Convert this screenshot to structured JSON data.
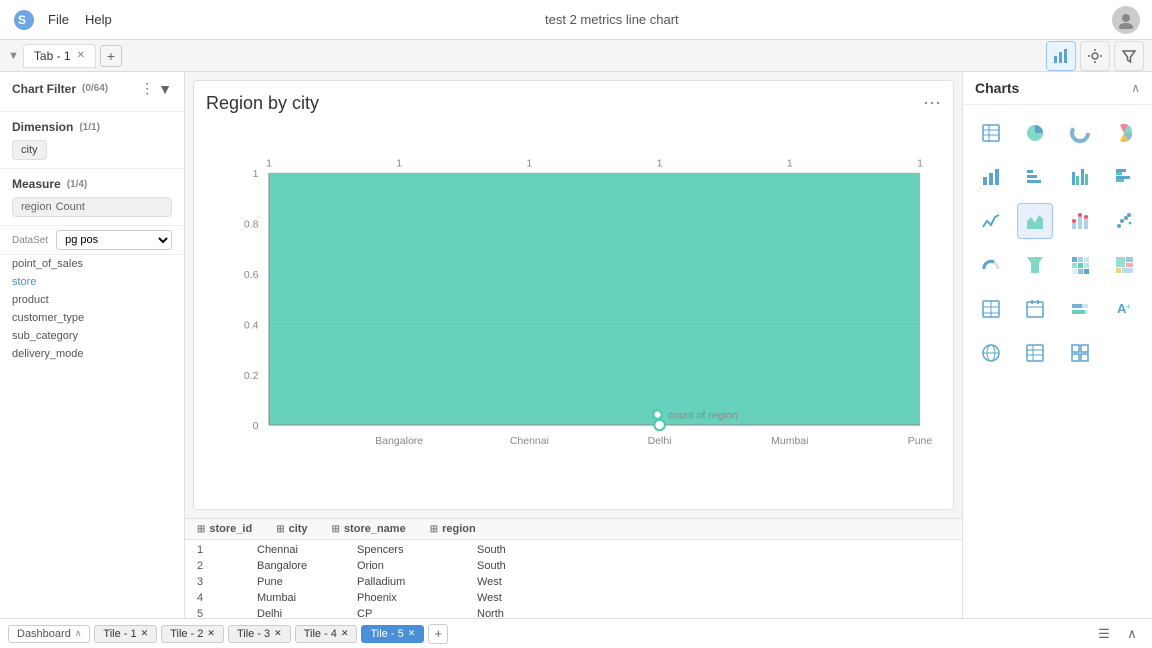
{
  "app": {
    "title": "test 2 metrics line chart",
    "menu": [
      "File",
      "Help"
    ]
  },
  "tabs": [
    {
      "label": "Tab - 1",
      "closable": true
    }
  ],
  "toolbar": {
    "chart_icon": "▦",
    "filter_icon": "⚙",
    "funnel_icon": "⊘"
  },
  "chart_filter": {
    "label": "Chart Filter",
    "badge": "(0/64)"
  },
  "dimension": {
    "label": "Dimension",
    "badge": "(1/1)",
    "value": "city"
  },
  "measure": {
    "label": "Measure",
    "badge": "(1/4)",
    "field": "region",
    "agg": "Count"
  },
  "chart_title": "Region by city",
  "chart": {
    "y_labels": [
      "1",
      "0.8",
      "0.6",
      "0.4",
      "0.2",
      "0"
    ],
    "x_labels": [
      "Bangalore",
      "Chennai",
      "Delhi",
      "Mumbai",
      "Pune"
    ],
    "x_top_labels": [
      "1",
      "1",
      "1",
      "1",
      "1"
    ],
    "series_label": "count of region"
  },
  "charts_panel": {
    "title": "Charts",
    "icons": [
      {
        "name": "table",
        "symbol": "⊞",
        "selected": false
      },
      {
        "name": "pie",
        "symbol": "◕",
        "selected": false
      },
      {
        "name": "donut",
        "symbol": "◎",
        "selected": false
      },
      {
        "name": "rose",
        "symbol": "✿",
        "selected": false
      },
      {
        "name": "bar",
        "symbol": "▮▮▮",
        "selected": false
      },
      {
        "name": "hbar",
        "symbol": "≡",
        "selected": false
      },
      {
        "name": "grouped-bar",
        "symbol": "▐▌",
        "selected": false
      },
      {
        "name": "grouped-hbar",
        "symbol": "≣",
        "selected": false
      },
      {
        "name": "line",
        "symbol": "📈",
        "selected": false
      },
      {
        "name": "area",
        "symbol": "◣",
        "selected": true
      },
      {
        "name": "scatter-bar",
        "symbol": "▬▬",
        "selected": false
      },
      {
        "name": "scatter",
        "symbol": "⠿",
        "selected": false
      },
      {
        "name": "gauge",
        "symbol": "◑",
        "selected": false
      },
      {
        "name": "funnel",
        "symbol": "▽",
        "selected": false
      },
      {
        "name": "heatmap",
        "symbol": "⊟",
        "selected": false
      },
      {
        "name": "treemap",
        "symbol": "▦",
        "selected": false
      },
      {
        "name": "table2",
        "symbol": "⊡",
        "selected": false
      },
      {
        "name": "calendar",
        "symbol": "▤",
        "selected": false
      },
      {
        "name": "bar2",
        "symbol": "▪▪▪",
        "selected": false
      },
      {
        "name": "text",
        "symbol": "A⁺",
        "selected": false
      },
      {
        "name": "geo1",
        "symbol": "⊕",
        "selected": false
      },
      {
        "name": "geo2",
        "symbol": "⊞",
        "selected": false
      },
      {
        "name": "grid",
        "symbol": "⊞",
        "selected": false
      }
    ]
  },
  "dataset": {
    "label": "DataSet",
    "selected": "pg pos",
    "options": [
      "pg pos"
    ],
    "items": [
      {
        "name": "point_of_sales",
        "active": false
      },
      {
        "name": "store",
        "active": true
      },
      {
        "name": "product",
        "active": false
      },
      {
        "name": "customer_type",
        "active": false
      },
      {
        "name": "sub_category",
        "active": false
      },
      {
        "name": "delivery_mode",
        "active": false
      }
    ]
  },
  "table": {
    "columns": [
      "store_id",
      "city",
      "store_name",
      "region"
    ],
    "rows": [
      {
        "store_id": "1",
        "city": "Chennai",
        "store_name": "Spencers",
        "region": "South"
      },
      {
        "store_id": "2",
        "city": "Bangalore",
        "store_name": "Orion",
        "region": "South"
      },
      {
        "store_id": "3",
        "city": "Pune",
        "store_name": "Palladium",
        "region": "West"
      },
      {
        "store_id": "4",
        "city": "Mumbai",
        "store_name": "Phoenix",
        "region": "West"
      },
      {
        "store_id": "5",
        "city": "Delhi",
        "store_name": "CP",
        "region": "North"
      }
    ]
  },
  "bottombar": {
    "dashboard": "Dashboard",
    "tiles": [
      {
        "label": "Tile - 1",
        "active": false
      },
      {
        "label": "Tile - 2",
        "active": false
      },
      {
        "label": "Tile - 3",
        "active": false
      },
      {
        "label": "Tile - 4",
        "active": false
      },
      {
        "label": "Tile - 5",
        "active": true
      }
    ]
  }
}
